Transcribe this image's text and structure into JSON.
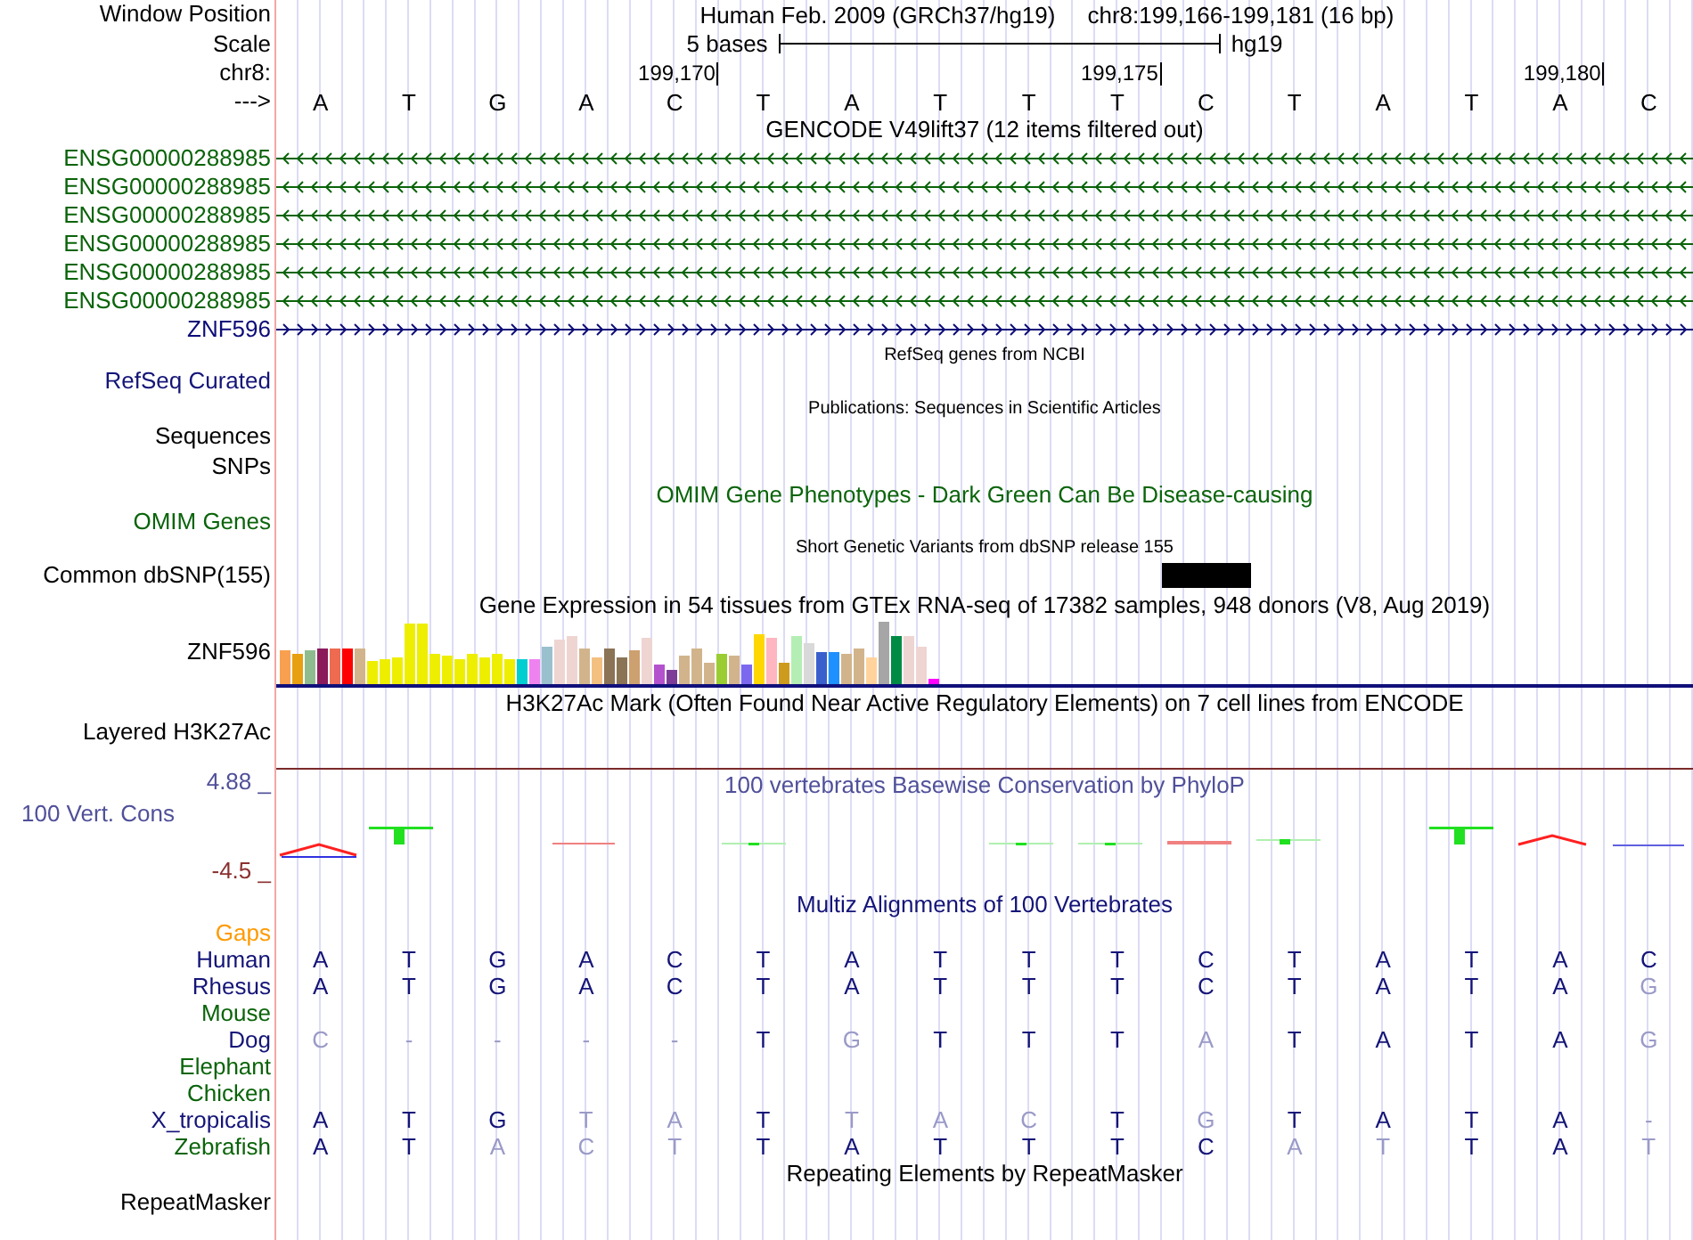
{
  "header": {
    "label": "Window Position",
    "assembly": "Human Feb. 2009 (GRCh37/hg19)",
    "position": "chr8:199,166-199,181 (16 bp)"
  },
  "scale": {
    "label": "Scale",
    "span": "5 bases",
    "assembly": "hg19"
  },
  "coordinates": {
    "label": "chr8:",
    "ticks": [
      "199,170",
      "199,175",
      "199,180"
    ]
  },
  "sequence": {
    "label": "--->",
    "bases": [
      "A",
      "T",
      "G",
      "A",
      "C",
      "T",
      "A",
      "T",
      "T",
      "T",
      "C",
      "T",
      "A",
      "T",
      "A",
      "C"
    ]
  },
  "gencode": {
    "title": "GENCODE V49lift37 (12 items filtered out)",
    "genes": [
      {
        "name": "ENSG00000288985",
        "reverse": true,
        "color": "#0a640a"
      },
      {
        "name": "ENSG00000288985",
        "reverse": true,
        "color": "#0a640a"
      },
      {
        "name": "ENSG00000288985",
        "reverse": true,
        "color": "#0a640a"
      },
      {
        "name": "ENSG00000288985",
        "reverse": true,
        "color": "#0a640a"
      },
      {
        "name": "ENSG00000288985",
        "reverse": true,
        "color": "#0a640a"
      },
      {
        "name": "ENSG00000288985",
        "reverse": true,
        "color": "#0a640a"
      },
      {
        "name": "ZNF596",
        "reverse": false,
        "color": "#0c0c78"
      }
    ]
  },
  "refseq": {
    "title": "RefSeq genes from NCBI",
    "label": "RefSeq Curated"
  },
  "publications": {
    "title": "Publications: Sequences in Scientific Articles",
    "labels": [
      "Sequences",
      "SNPs"
    ]
  },
  "omim": {
    "title": "OMIM Gene Phenotypes - Dark Green Can Be Disease-causing",
    "label": "OMIM Genes"
  },
  "dbsnp": {
    "title": "Short Genetic Variants from dbSNP release 155",
    "label": "Common dbSNP(155)"
  },
  "gtex": {
    "title": "Gene Expression in 54 tissues from GTEx RNA-seq of 17382 samples, 948 donors (V8, Aug 2019)",
    "label": "ZNF596"
  },
  "h3k27ac": {
    "title": "H3K27Ac Mark (Often Found Near Active Regulatory Elements) on 7 cell lines from ENCODE",
    "label": "Layered H3K27Ac"
  },
  "phylop": {
    "title": "100 vertebrates Basewise Conservation by PhyloP",
    "label": "100 Vert. Cons",
    "max": "4.88 _",
    "min": "-4.5 _"
  },
  "multiz": {
    "title": "Multiz Alignments of 100 Vertebrates",
    "gaps_label": "Gaps",
    "species": [
      {
        "name": "Human",
        "color": "#141478",
        "bases": [
          {
            "base": "A",
            "match": true
          },
          {
            "base": "T",
            "match": true
          },
          {
            "base": "G",
            "match": true
          },
          {
            "base": "A",
            "match": true
          },
          {
            "base": "C",
            "match": true
          },
          {
            "base": "T",
            "match": true
          },
          {
            "base": "A",
            "match": true
          },
          {
            "base": "T",
            "match": true
          },
          {
            "base": "T",
            "match": true
          },
          {
            "base": "T",
            "match": true
          },
          {
            "base": "C",
            "match": true
          },
          {
            "base": "T",
            "match": true
          },
          {
            "base": "A",
            "match": true
          },
          {
            "base": "T",
            "match": true
          },
          {
            "base": "A",
            "match": true
          },
          {
            "base": "C",
            "match": true
          }
        ]
      },
      {
        "name": "Rhesus",
        "color": "#141478",
        "bases": [
          {
            "base": "A",
            "match": true
          },
          {
            "base": "T",
            "match": true
          },
          {
            "base": "G",
            "match": true
          },
          {
            "base": "A",
            "match": true
          },
          {
            "base": "C",
            "match": true
          },
          {
            "base": "T",
            "match": true
          },
          {
            "base": "A",
            "match": true
          },
          {
            "base": "T",
            "match": true
          },
          {
            "base": "T",
            "match": true
          },
          {
            "base": "T",
            "match": true
          },
          {
            "base": "C",
            "match": true
          },
          {
            "base": "T",
            "match": true
          },
          {
            "base": "A",
            "match": true
          },
          {
            "base": "T",
            "match": true
          },
          {
            "base": "A",
            "match": true
          },
          {
            "base": "G",
            "match": false
          }
        ]
      },
      {
        "name": "Mouse",
        "color": "#0a640a"
      },
      {
        "name": "Dog",
        "color": "#141478",
        "bases": [
          {
            "base": "C",
            "match": false
          },
          {
            "base": "-",
            "match": false
          },
          {
            "base": "-",
            "match": false
          },
          {
            "base": "-",
            "match": false
          },
          {
            "base": "-",
            "match": false
          },
          {
            "base": "T",
            "match": true
          },
          {
            "base": "G",
            "match": false
          },
          {
            "base": "T",
            "match": true
          },
          {
            "base": "T",
            "match": true
          },
          {
            "base": "T",
            "match": true
          },
          {
            "base": "A",
            "match": false
          },
          {
            "base": "T",
            "match": true
          },
          {
            "base": "A",
            "match": true
          },
          {
            "base": "T",
            "match": true
          },
          {
            "base": "A",
            "match": true
          },
          {
            "base": "G",
            "match": false
          }
        ]
      },
      {
        "name": "Elephant",
        "color": "#0a640a"
      },
      {
        "name": "Chicken",
        "color": "#0a640a"
      },
      {
        "name": "X_tropicalis",
        "color": "#141478",
        "bases": [
          {
            "base": "A",
            "match": true
          },
          {
            "base": "T",
            "match": true
          },
          {
            "base": "G",
            "match": true
          },
          {
            "base": "T",
            "match": false
          },
          {
            "base": "A",
            "match": false
          },
          {
            "base": "T",
            "match": true
          },
          {
            "base": "T",
            "match": false
          },
          {
            "base": "A",
            "match": false
          },
          {
            "base": "C",
            "match": false
          },
          {
            "base": "T",
            "match": true
          },
          {
            "base": "G",
            "match": false
          },
          {
            "base": "T",
            "match": true
          },
          {
            "base": "A",
            "match": true
          },
          {
            "base": "T",
            "match": true
          },
          {
            "base": "A",
            "match": true
          },
          {
            "base": "-",
            "match": false
          }
        ]
      },
      {
        "name": "Zebrafish",
        "color": "#0a640a",
        "bases": [
          {
            "base": "A",
            "match": true
          },
          {
            "base": "T",
            "match": true
          },
          {
            "base": "A",
            "match": false
          },
          {
            "base": "C",
            "match": false
          },
          {
            "base": "T",
            "match": false
          },
          {
            "base": "T",
            "match": true
          },
          {
            "base": "A",
            "match": true
          },
          {
            "base": "T",
            "match": true
          },
          {
            "base": "T",
            "match": true
          },
          {
            "base": "T",
            "match": true
          },
          {
            "base": "C",
            "match": true
          },
          {
            "base": "A",
            "match": false
          },
          {
            "base": "T",
            "match": false
          },
          {
            "base": "T",
            "match": true
          },
          {
            "base": "A",
            "match": true
          },
          {
            "base": "T",
            "match": false
          }
        ]
      }
    ]
  },
  "repeatmasker": {
    "title": "Repeating Elements by RepeatMasker",
    "label": "RepeatMasker"
  }
}
